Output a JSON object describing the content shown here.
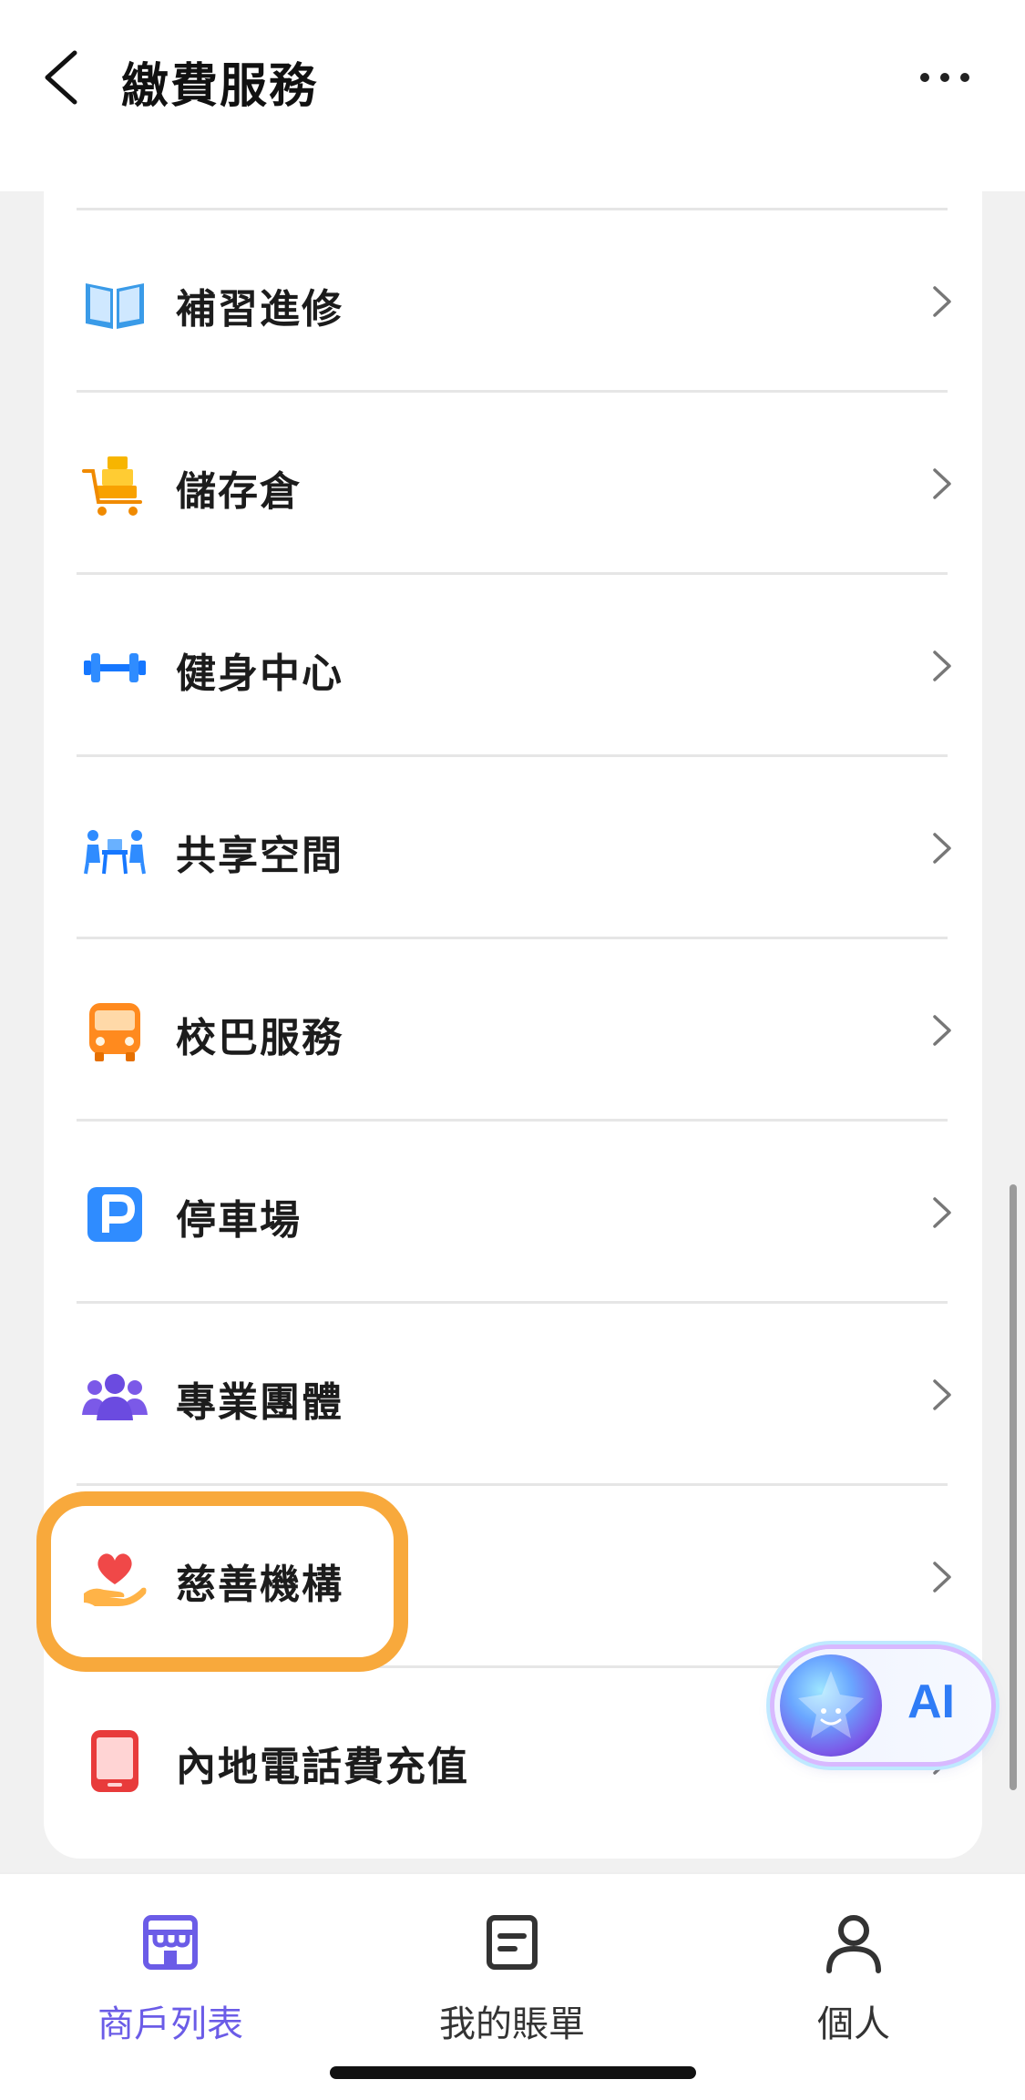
{
  "header": {
    "title": "繳費服務",
    "back_icon": "chevron-left-icon",
    "more_icon": "more-horizontal-icon"
  },
  "list": {
    "items": [
      {
        "label": "補習進修",
        "icon": "open-book-icon"
      },
      {
        "label": "儲存倉",
        "icon": "storage-cart-icon"
      },
      {
        "label": "健身中心",
        "icon": "dumbbell-icon"
      },
      {
        "label": "共享空間",
        "icon": "coworking-icon"
      },
      {
        "label": "校巴服務",
        "icon": "school-bus-icon"
      },
      {
        "label": "停車場",
        "icon": "parking-icon"
      },
      {
        "label": "專業團體",
        "icon": "people-group-icon"
      },
      {
        "label": "慈善機構",
        "icon": "heart-hand-icon"
      },
      {
        "label": "內地電話費充值",
        "icon": "phone-icon"
      }
    ],
    "highlighted_item": "慈善機構"
  },
  "ai_button": {
    "label": "AI"
  },
  "tabs": [
    {
      "label": "商戶列表",
      "icon": "store-icon",
      "active": true
    },
    {
      "label": "我的賬單",
      "icon": "bill-icon",
      "active": false
    },
    {
      "label": "個人",
      "icon": "person-icon",
      "active": false
    }
  ],
  "colors": {
    "accent": "#6b5ce7",
    "highlight": "#f8a93c",
    "ai_text": "#2f7cf6"
  }
}
